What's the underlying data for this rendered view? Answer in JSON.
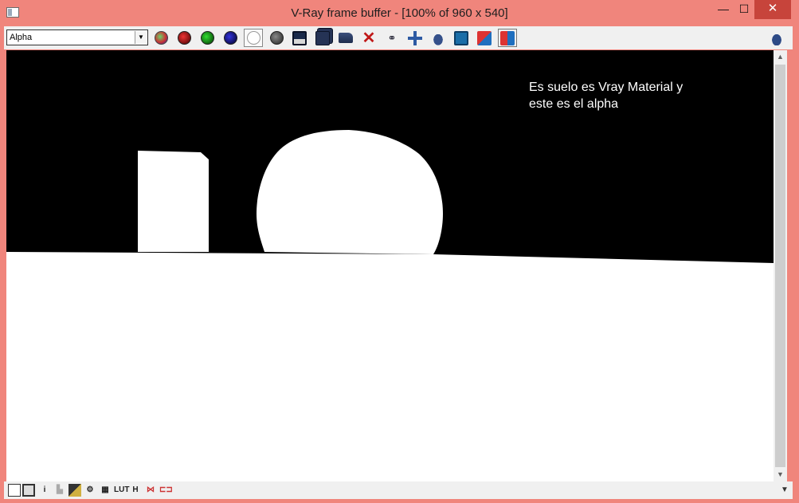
{
  "window": {
    "title": "V-Ray frame buffer - [100% of 960 x 540]",
    "minimize_glyph": "—",
    "maximize_glyph": "☐",
    "close_glyph": "✕"
  },
  "toolbar": {
    "channel_value": "Alpha",
    "buttons": [
      "show-rgb-channels",
      "red-channel",
      "green-channel",
      "blue-channel",
      "view-alpha-channel",
      "monochromatic-mode",
      "save-image",
      "save-all-image-channels",
      "load-image",
      "clear-image",
      "track-mouse",
      "region-render",
      "render-last",
      "link-to-vfb-history",
      "compare-a-b-horizontal",
      "compare-a-b-vertical",
      "render"
    ]
  },
  "viewport": {
    "annotation": "Es suelo es Vray Material y\neste es el alpha"
  },
  "statusbar": {
    "lut_label": "LUT",
    "h_label": "H",
    "info_label": "i"
  },
  "colors": {
    "window_frame": "#f0857c",
    "close_button": "#c7443b",
    "alpha_background": "#000000",
    "alpha_object": "#ffffff"
  }
}
